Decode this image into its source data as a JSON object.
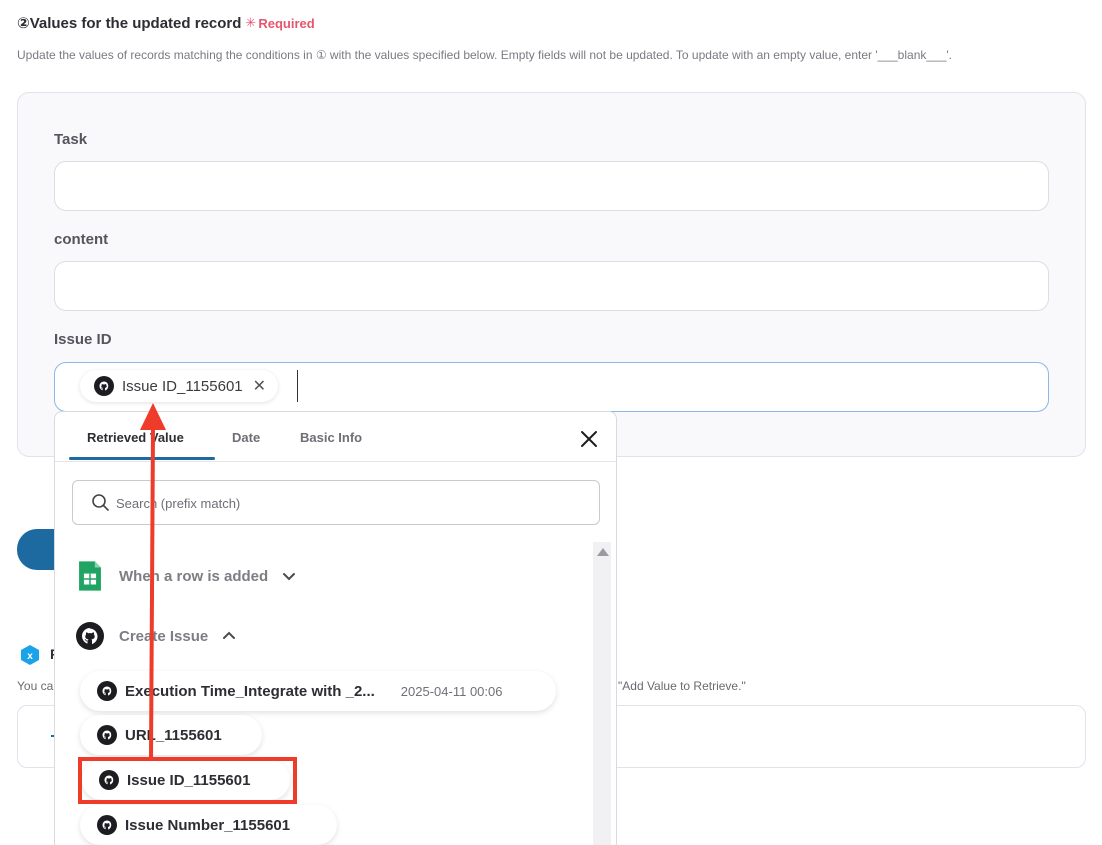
{
  "section": {
    "title": "②Values for the updated record",
    "required": "Required",
    "description": "Update the values of records matching the conditions in ① with the values specified below. Empty fields will not be updated. To update with an empty value, enter '___blank___'."
  },
  "fields": [
    {
      "label": "Task",
      "value": ""
    },
    {
      "label": "content",
      "value": ""
    },
    {
      "label": "Issue ID",
      "chip": "Issue ID_1155601"
    }
  ],
  "background": {
    "section_letter": "R",
    "hint_left": "You ca",
    "hint_right": "\"Add Value to Retrieve.\""
  },
  "dropdown": {
    "tabs": [
      "Retrieved Value",
      "Date",
      "Basic Info"
    ],
    "active_tab": "Retrieved Value",
    "search_placeholder": "Search (prefix match)",
    "groups": [
      {
        "name": "When a row is added",
        "icon": "google-sheets-icon",
        "expanded": false
      },
      {
        "name": "Create Issue",
        "icon": "github-icon",
        "expanded": true
      }
    ],
    "items": [
      {
        "label": "Execution Time_Integrate with _2...",
        "sub": "2025-04-11 00:06"
      },
      {
        "label": "URL_1155601"
      },
      {
        "label": "Issue ID_1155601",
        "highlighted": true
      },
      {
        "label": "Issue Number_1155601"
      }
    ]
  },
  "colors": {
    "accent": "#1c6aa0",
    "required": "#e5566e",
    "annotation": "#ee3b2a"
  }
}
